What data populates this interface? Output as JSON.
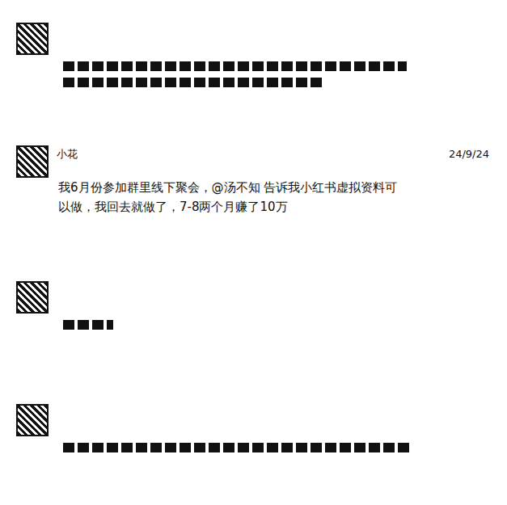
{
  "messages": [
    {
      "kind": "redacted"
    },
    {
      "kind": "text",
      "name": "小花",
      "date": "24/9/24",
      "text": "我6月份参加群里线下聚会，@汤不知 告诉我小红书虚拟资料可以做，我回去就做了，7-8两个月赚了10万"
    },
    {
      "kind": "redacted"
    },
    {
      "kind": "redacted"
    }
  ]
}
